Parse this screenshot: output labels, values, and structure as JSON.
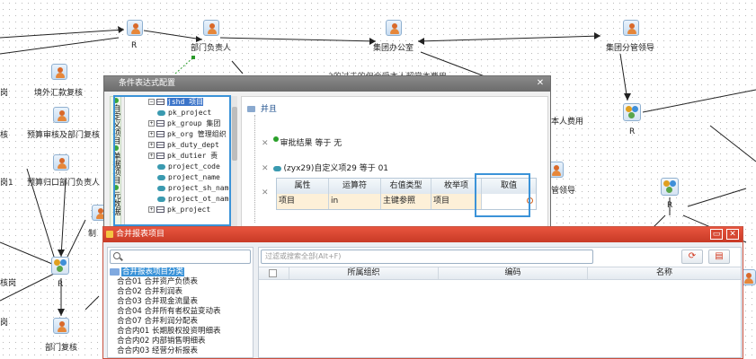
{
  "workflow": {
    "nodes": {
      "r_top": "R",
      "dept_head": "部门负责人",
      "group_office": "集团办公室",
      "group_leader": "集团分管领导",
      "overseas_review": "境外汇款复核",
      "budget_review": "预算审核及部门复核",
      "budget_dept_head": "预算归口部门负责人",
      "dept_review": "部门复核",
      "r_left": "R",
      "r_right_top": "R",
      "r_right": "R",
      "self_fee": "本人费用",
      "leader_partial": "管领导",
      "partial_1": "岗",
      "partial_2": "核",
      "partial_3": "岗1",
      "partial_4": "核岗",
      "partial_5": "岗",
      "partial_6": "制",
      "overlap_text": "3的过去的但会受本人超常本费用"
    }
  },
  "condition_dialog": {
    "title": "条件表达式配置",
    "close": "✕",
    "side_tabs": [
      "自定义项目",
      "单据项目",
      "元数据"
    ],
    "tree": [
      {
        "pm": "⊟",
        "icon": "table",
        "text": "jshd 项目",
        "selected": true
      },
      {
        "pm": "",
        "icon": "key",
        "text": "pk_project"
      },
      {
        "pm": "⊞",
        "icon": "table",
        "text": "pk_group 集团"
      },
      {
        "pm": "⊞",
        "icon": "table",
        "text": "pk_org 管理组织"
      },
      {
        "pm": "⊞",
        "icon": "table",
        "text": "pk_duty_dept"
      },
      {
        "pm": "⊞",
        "icon": "table",
        "text": "pk_dutier 责"
      },
      {
        "pm": "",
        "icon": "key",
        "text": "project_code"
      },
      {
        "pm": "",
        "icon": "key",
        "text": "project_name"
      },
      {
        "pm": "",
        "icon": "key",
        "text": "project_sh_name"
      },
      {
        "pm": "",
        "icon": "key",
        "text": "project_ot_name"
      },
      {
        "pm": "⊞",
        "icon": "table",
        "text": "pk_project"
      }
    ],
    "root_label": "并且",
    "cond1": "审批结果 等于 无",
    "cond2": "(zyx29)自定义项29 等于 01",
    "grid_headers": [
      "属性",
      "运算符",
      "右值类型",
      "枚举项",
      "取值"
    ],
    "grid_row": [
      "项目",
      "in",
      "主键参照",
      "项目",
      ""
    ]
  },
  "merge_dialog": {
    "title": "合并报表项目",
    "btn_min": "▭",
    "btn_close": "✕",
    "search_placeholder": "",
    "filter_placeholder": "过滤或搜索全部(Alt+F)",
    "root": "合并报表项目分类",
    "items": [
      "合合01 合并资产负债表",
      "合合02 合并利润表",
      "合合03 合并现金流量表",
      "合合04 合并所有者权益变动表",
      "合合07 合并利润分配表",
      "合合内01 长期股权投资明细表",
      "合合内02 内部销售明细表",
      "合合内03 经营分析报表"
    ],
    "columns": [
      "",
      "所属组织",
      "编码",
      "名称"
    ],
    "colors": {
      "title": "#d6452f",
      "selection": "#3b93d8"
    }
  }
}
